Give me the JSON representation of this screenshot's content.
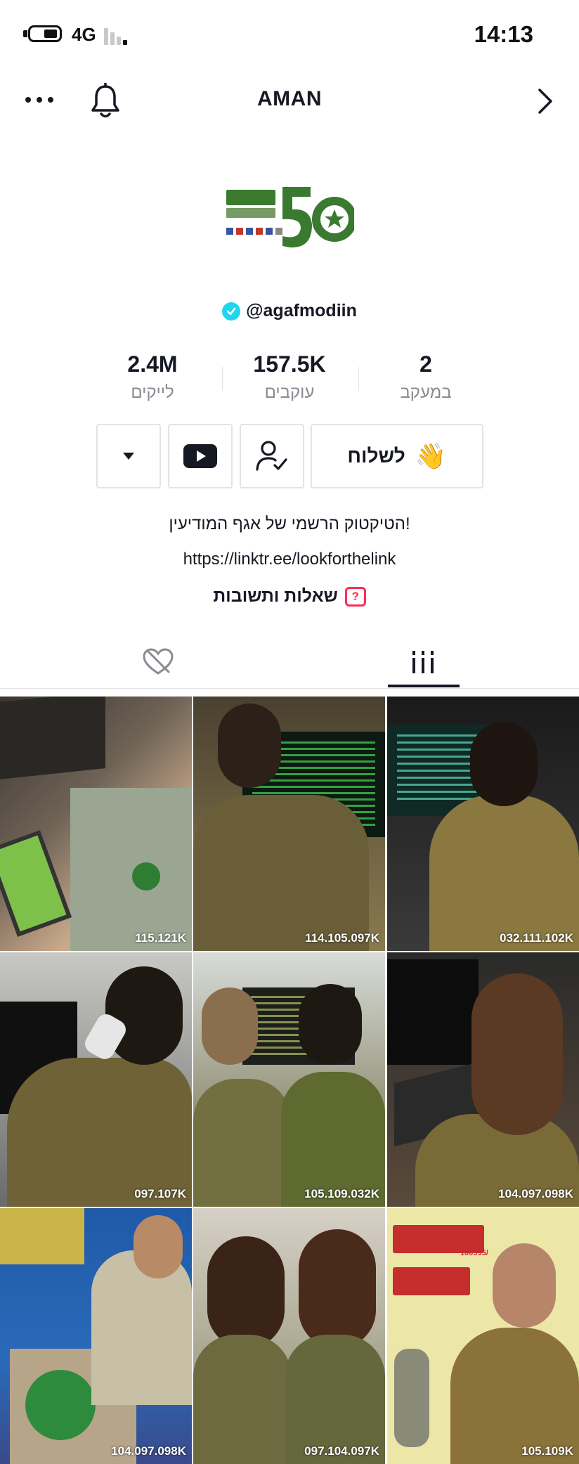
{
  "status_bar": {
    "network": "4G",
    "time": "14:13"
  },
  "header": {
    "title": "AMAN"
  },
  "profile": {
    "username": "@agafmodiin",
    "stats": [
      {
        "value": "2",
        "label": "במעקב"
      },
      {
        "value": "157.5K",
        "label": "עוקבים"
      },
      {
        "value": "2.4M",
        "label": "לייקים"
      }
    ],
    "message_button": "לשלוח",
    "bio_line": "הטיקטוק הרשמי של אגף המודיעין!",
    "link": "https://linktr.ee/lookforthelink",
    "qa_label": "שאלות ותשובות"
  },
  "videos": [
    {
      "views": "115.121K"
    },
    {
      "views": "114.105.097K"
    },
    {
      "views": "032.111.102K"
    },
    {
      "views": "097.107K"
    },
    {
      "views": "105.109.032K"
    },
    {
      "views": "104.097.098K"
    },
    {
      "views": "104.097.098K"
    },
    {
      "views": "097.104.097K"
    },
    {
      "views": "105.109K"
    }
  ],
  "thumb_text": {
    "poster_number": "100995/"
  },
  "colors": {
    "accent": "#fe2c55",
    "verified": "#20d5ec",
    "logo_green": "#3a7a30"
  }
}
